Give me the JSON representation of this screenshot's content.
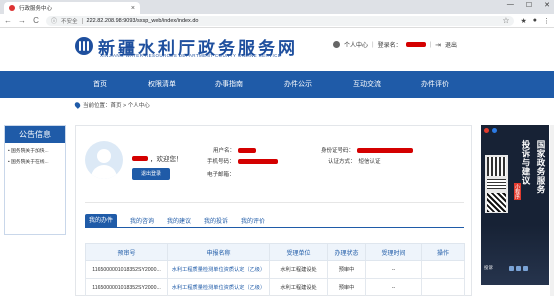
{
  "browser": {
    "tab_title": "行政服务中心",
    "tab_close": "×",
    "win_min": "—",
    "win_max": "☐",
    "win_close": "✕",
    "back": "←",
    "forward": "→",
    "reload": "C",
    "security_label": "不安全",
    "url": "222.82.208.98:9093/sxsp_web/index/index.do",
    "star": "☆",
    "ext_icon": "★",
    "account_icon": "●",
    "menu_icon": "⋮"
  },
  "site": {
    "title": "新疆水利厅政务服务网",
    "subtitle": "XINJIANG WATER RESOURCES DEPARTMENT  COUNTY  ONLINE  SERVICE",
    "user_center": "个人中心",
    "login_name_label": "登录名：",
    "logout": "退出"
  },
  "nav": {
    "items": [
      "首页",
      "权限清单",
      "办事指南",
      "办件公示",
      "互动交流",
      "办件评价"
    ]
  },
  "breadcrumb": {
    "text": "当前位置：首页 > 个人中心"
  },
  "notice": {
    "title": "公告信息",
    "items": [
      "• 国务院关于加快...",
      "• 国务院关于在线..."
    ]
  },
  "profile": {
    "welcome": "，欢迎您！",
    "logout_button": "退出登录",
    "name_label": "用户名：",
    "phone_label": "手机号码：",
    "email_label": "电子邮箱：",
    "id_label": "身份证号码：",
    "auth_label": "认证方式：",
    "auth_value": "短信认证"
  },
  "subtabs": [
    "我的办件",
    "我的咨询",
    "我的建议",
    "我的投诉",
    "我的评价"
  ],
  "table": {
    "headers": [
      "预审号",
      "申报名称",
      "受理单位",
      "办理状态",
      "受理时间",
      "操作"
    ],
    "rows": [
      {
        "id": "1165000001018352SY2000...",
        "name": "水利工程质量检测单位资质认定（乙级）",
        "unit": "水利工程建设处",
        "status": "预审中",
        "time": "--",
        "action": ""
      },
      {
        "id": "1165000001018352SY2000...",
        "name": "水利工程质量检测单位资质认定（乙级）",
        "unit": "水利工程建设处",
        "status": "预审中",
        "time": "--",
        "action": ""
      }
    ]
  },
  "ad": {
    "vertical_lines": [
      "国家政务服务",
      "投诉与建议"
    ],
    "tag": "小程序",
    "bottom_label": "投诉"
  }
}
